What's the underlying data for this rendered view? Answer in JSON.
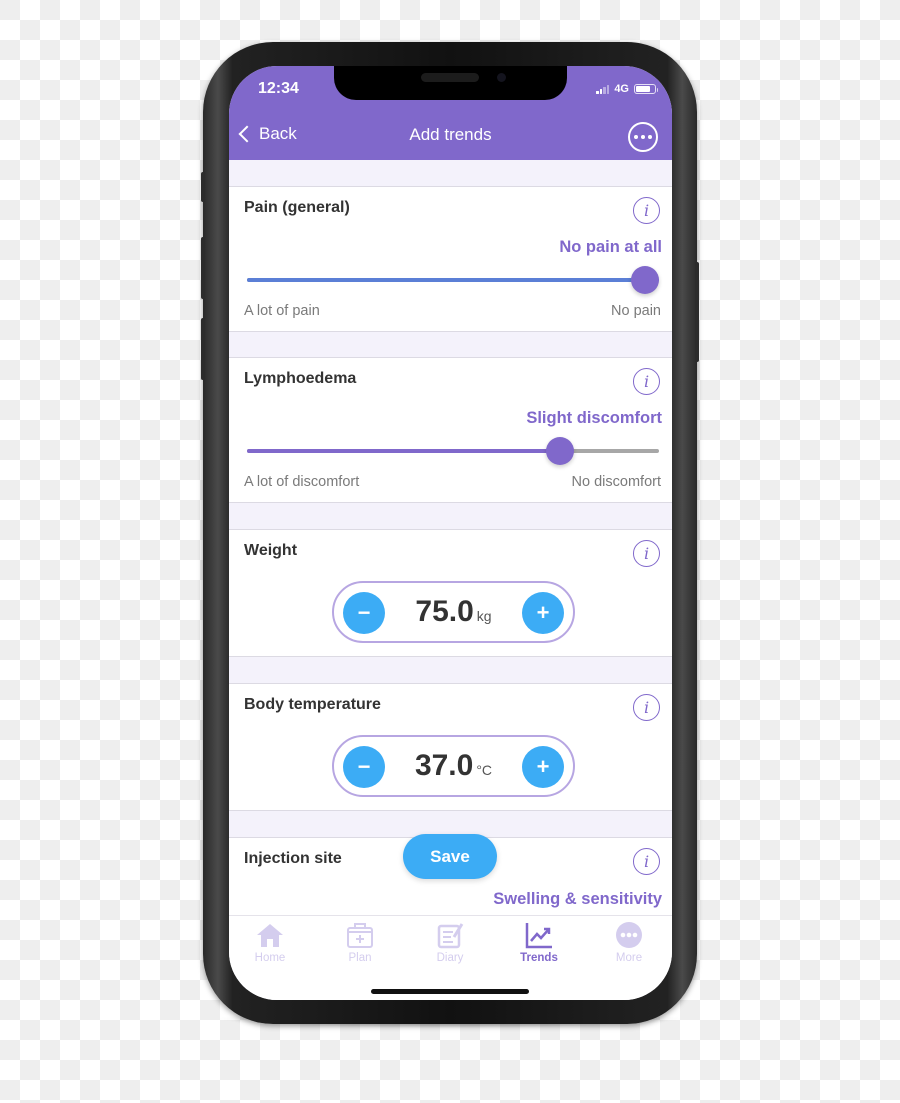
{
  "status_bar": {
    "time": "12:34",
    "network": "4G",
    "signal_bars_active": 2,
    "signal_bars_total": 4,
    "battery_level": 0.75
  },
  "nav": {
    "back_label": "Back",
    "title": "Add trends",
    "more_icon": "more-circle-icon"
  },
  "colors": {
    "brand_purple": "#8068cb",
    "accent_blue": "#3cacf5",
    "slider_blue": "#5b7fd6"
  },
  "cards": {
    "pain": {
      "title": "Pain (general)",
      "value_label": "No pain at all",
      "min_label": "A lot of pain",
      "max_label": "No pain",
      "slider_value": 1.0
    },
    "lymphoedema": {
      "title": "Lymphoedema",
      "value_label": "Slight discomfort",
      "min_label": "A lot of discomfort",
      "max_label": "No discomfort",
      "slider_value": 0.76
    },
    "weight": {
      "title": "Weight",
      "value": "75.0",
      "unit": "kg",
      "minus": "−",
      "plus": "+"
    },
    "temperature": {
      "title": "Body temperature",
      "value": "37.0",
      "unit": "°C",
      "minus": "−",
      "plus": "+"
    },
    "injection": {
      "title": "Injection site",
      "value_label": "Swelling & sensitivity"
    }
  },
  "save_label": "Save",
  "info_glyph": "i",
  "tabs": [
    {
      "label": "Home",
      "icon": "home-icon",
      "active": false
    },
    {
      "label": "Plan",
      "icon": "plan-kit-icon",
      "active": false
    },
    {
      "label": "Diary",
      "icon": "diary-icon",
      "active": false
    },
    {
      "label": "Trends",
      "icon": "trends-chart-icon",
      "active": true
    },
    {
      "label": "More",
      "icon": "more-dots-icon",
      "active": false
    }
  ]
}
